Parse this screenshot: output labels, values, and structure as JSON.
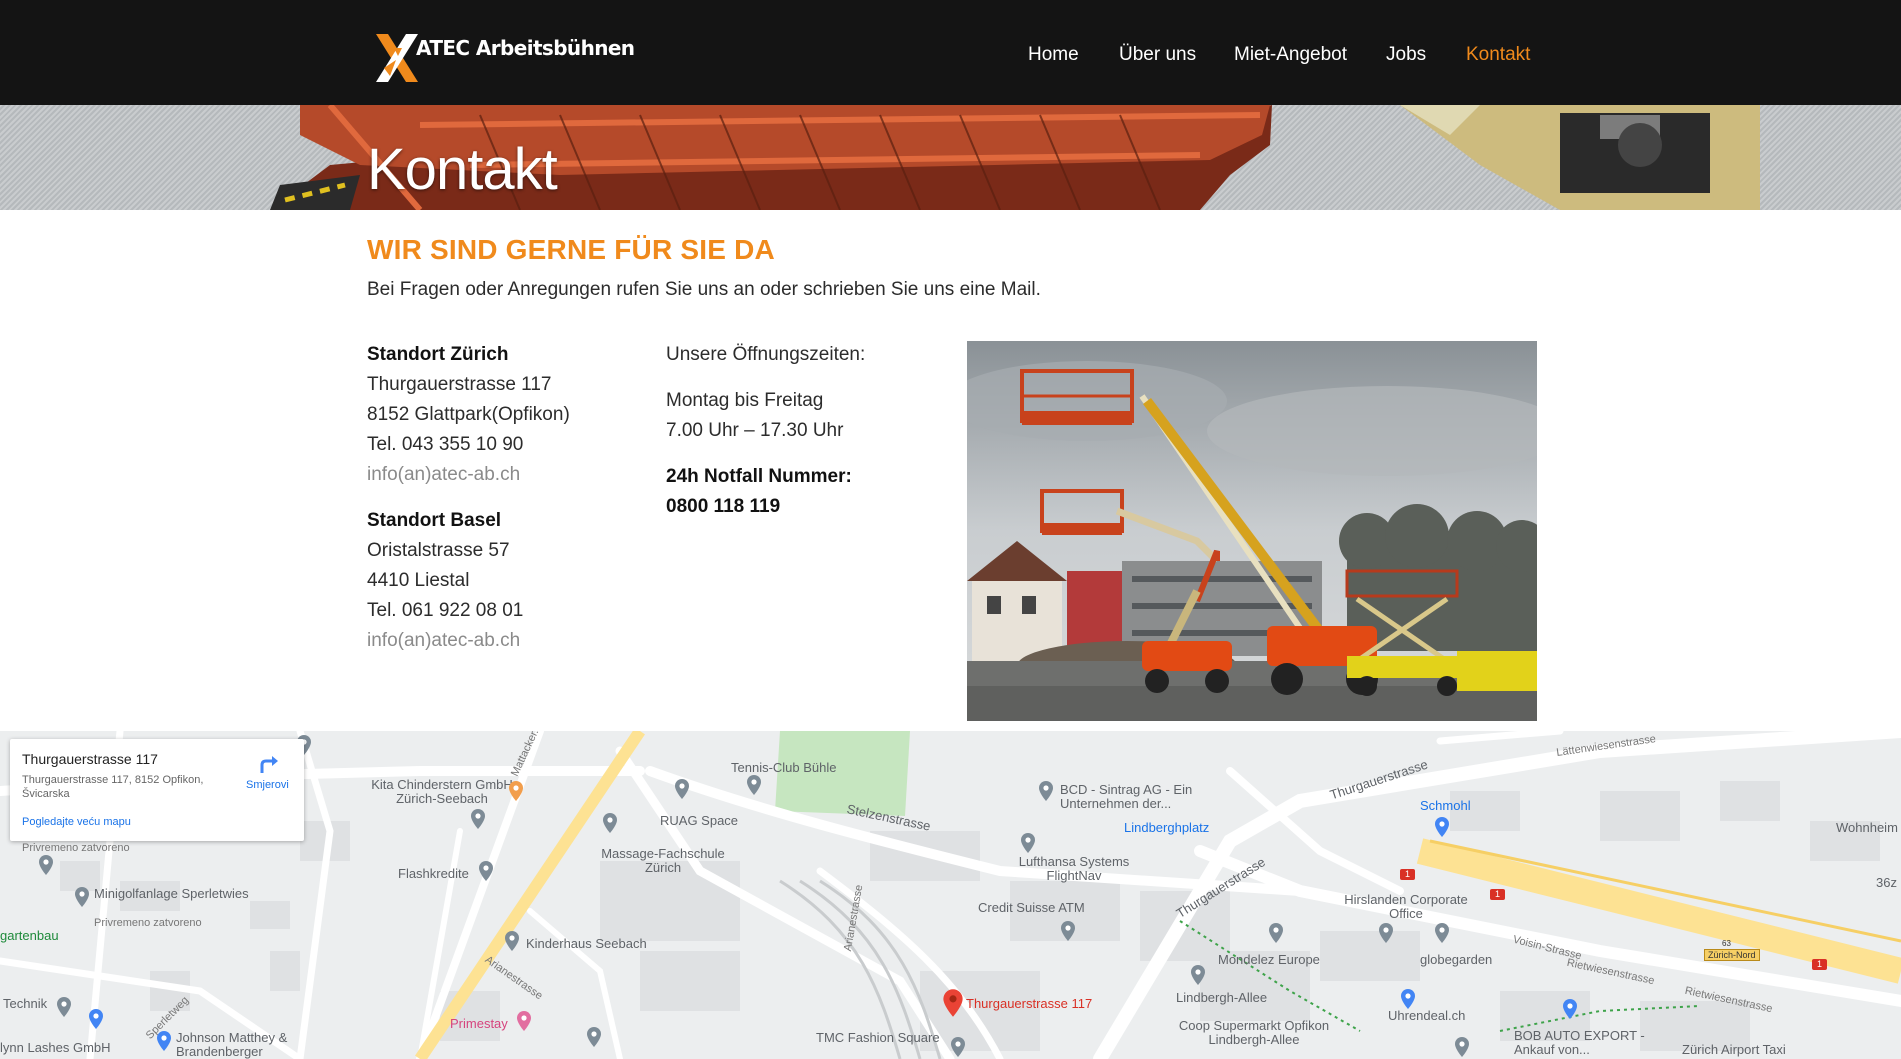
{
  "header": {
    "logo_text": "ATEC Arbeitsbühnen",
    "nav": [
      {
        "label": "Home",
        "active": false
      },
      {
        "label": "Über uns",
        "active": false
      },
      {
        "label": "Miet-Angebot",
        "active": false
      },
      {
        "label": "Jobs",
        "active": false
      },
      {
        "label": "Kontakt",
        "active": true
      }
    ]
  },
  "hero": {
    "title": "Kontakt"
  },
  "content": {
    "headline": "WIR SIND GERNE FÜR SIE DA",
    "intro": "Bei Fragen oder Anregungen rufen Sie uns an oder schrieben Sie uns eine Mail.",
    "zurich": {
      "title": "Standort Zürich",
      "street": "Thurgauerstrasse 117",
      "city": "8152 Glattpark(Opfikon)",
      "phone": "Tel. 043 355 10 90",
      "email": "info(an)atec-ab.ch"
    },
    "basel": {
      "title": "Standort Basel",
      "street": "Oristalstrasse 57",
      "city": "4410 Liestal",
      "phone": "Tel. 061 922 08 01",
      "email": "info(an)atec-ab.ch"
    },
    "hours": {
      "title": "Unsere Öffnungszeiten:",
      "days": "Montag bis Freitag",
      "time": "7.00 Uhr – 17.30 Uhr",
      "emergency_label": "24h Notfall Nummer:",
      "emergency_number": "0800 118 119"
    }
  },
  "map": {
    "infocard": {
      "title": "Thurgauerstrasse 117",
      "address": "Thurgauerstrasse 117, 8152 Opfikon, Švicarska",
      "directions": "Smjerovi",
      "larger_map": "Pogledajte veću mapu"
    },
    "labels": {
      "privremeno1": "Privremeno zatvoreno",
      "minigolf": "Minigolfanlage Sperletwies",
      "privremeno2": "Privremeno zatvoreno",
      "gartenbau": "gartenbau",
      "technik": "Technik",
      "lashes": "lynn Lashes GmbH",
      "johnson": "Johnson Matthey & Brandenberger",
      "kita": "Kita Chinderstern GmbH Zürich-Seebach",
      "mattacker": "Mattacker...",
      "flashkredite": "Flashkredite",
      "kinderhaus": "Kinderhaus Seebach",
      "primestay": "Primestay",
      "ruag": "RUAG Space",
      "massage": "Massage-Fachschule Zürich",
      "tennis": "Tennis-Club Bühl​e",
      "stelzen": "Stelzenstrasse",
      "arianestrasse": "Arianestrasse",
      "bcd": "BCD - Sintrag AG - Ein Unternehmen der...",
      "lindberghplatz": "Lindberghplatz",
      "lufthansa": "Lufthansa Systems FlightNav",
      "creditsuisse": "Credit Suisse ATM",
      "thurgauer_pin": "Thurgauerstrasse 117",
      "tmc": "TMC Fashion Square",
      "thurgauerstrasse1": "Thurgauerstrasse",
      "thurgauerstrasse2": "Thurgauerstrasse",
      "schmohl": "Schmohl",
      "hirslanden": "Hirslanden Corporate Office",
      "mondelez": "Mondelez Europe",
      "globegarden": "globegarden",
      "lindbergh_allee": "Lindbergh-Allee",
      "coop": "Coop Supermarkt Opfikon Lindbergh-Allee",
      "uhrendeal": "Uhrendeal.ch",
      "bob": "BOB AUTO EXPORT - Ankauf von...",
      "airport_taxi": "Zürich Airport Taxi",
      "voisin": "Voisin-Strasse",
      "rietwiesen1": "Rietwiesenstrasse",
      "rietwiesen2": "Rietwiesenstrasse",
      "lattenwiesen": "Lättenwiesenstrasse",
      "wohnheim": "Wohnheim",
      "zurich_nord": "Zürich-Nord",
      "a63": "63",
      "a1a": "1",
      "a1b": "1",
      "a1c": "1",
      "a36": "36z",
      "seebach": "Sperletweg"
    }
  },
  "colors": {
    "accent": "#f08a1c",
    "header_bg": "#141414"
  }
}
